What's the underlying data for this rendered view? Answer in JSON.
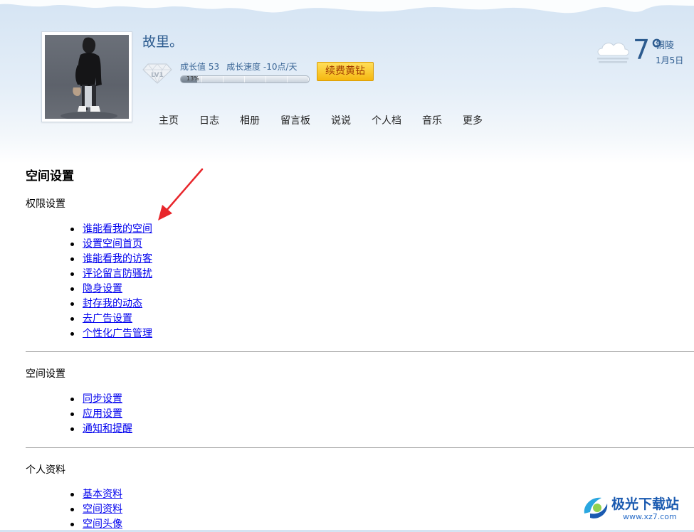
{
  "profile": {
    "nickname": "故里。",
    "level": "LV1",
    "growth_value_label": "成长值 53",
    "growth_speed_label": "成长速度 -10点/天",
    "progress_label": "13%",
    "progress_fraction": 0.13,
    "renew_button": "续费黄钻"
  },
  "nav": {
    "items": [
      "主页",
      "日志",
      "相册",
      "留言板",
      "说说",
      "个人档",
      "音乐",
      "更多"
    ]
  },
  "weather": {
    "temperature": "7°",
    "city": "铜陵",
    "date": "1月5日",
    "icon": "cloudy-icon"
  },
  "content": {
    "title": "空间设置",
    "sections": [
      {
        "heading": "权限设置",
        "links": [
          "谁能看我的空间 ",
          "设置空间首页 ",
          "谁能看我的访客 ",
          "评论留言防骚扰 ",
          "隐身设置 ",
          "封存我的动态 ",
          "去广告设置 ",
          "个性化广告管理 "
        ]
      },
      {
        "heading": "空间设置",
        "links": [
          "同步设置 ",
          "应用设置 ",
          "通知和提醒 "
        ]
      },
      {
        "heading": "个人资料",
        "links": [
          "基本资料 ",
          "空间资料 ",
          "空间头像 "
        ]
      }
    ]
  },
  "watermark": {
    "name": "极光下载站",
    "url": "www.xz7.com"
  },
  "colors": {
    "link": "#0000ee",
    "accent": "#2c5b8f",
    "renew_button_bg": "#f5b70f",
    "arrow": "#e8262b"
  }
}
